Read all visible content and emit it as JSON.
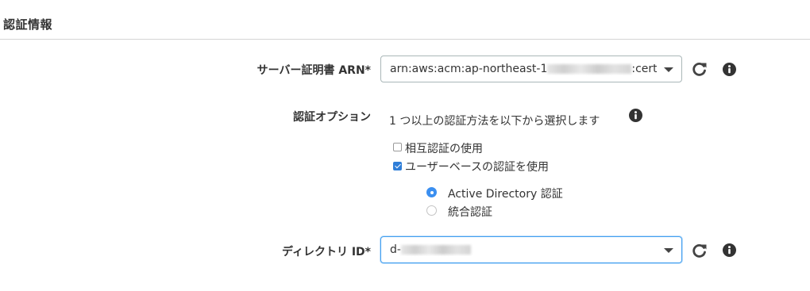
{
  "section": {
    "title": "認証情報"
  },
  "server_cert": {
    "label": "サーバー証明書 ARN*",
    "value_prefix": "arn:aws:acm:ap-northeast-1",
    "value_suffix": ":certi"
  },
  "auth_options": {
    "label": "認証オプション",
    "description": "1 つ以上の認証方法を以下から選択します",
    "mutual_auth": {
      "label": "相互認証の使用",
      "checked": false
    },
    "user_based": {
      "label": "ユーザーベースの認証を使用",
      "checked": true
    },
    "radio_options": [
      {
        "label": "Active Directory 認証",
        "selected": true
      },
      {
        "label": "統合認証",
        "selected": false
      }
    ]
  },
  "directory": {
    "label": "ディレクトリ ID*",
    "value_prefix": "d-"
  },
  "icons": {
    "refresh": "refresh-icon",
    "info": "info-icon",
    "caret": "chevron-down-icon"
  },
  "colors": {
    "focus_border": "#44a0f0",
    "checkbox_checked": "#2f7ed8",
    "radio_selected": "#3b8ff0"
  }
}
